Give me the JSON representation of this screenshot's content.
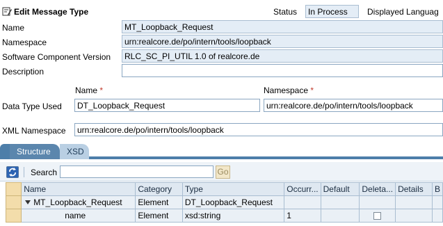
{
  "header": {
    "title": "Edit Message Type",
    "status_label": "Status",
    "status_value": "In Process",
    "displayed_language_label": "Displayed Languag"
  },
  "form": {
    "name_label": "Name",
    "name_value": "MT_Loopback_Request",
    "namespace_label": "Namespace",
    "namespace_value": "urn:realcore.de/po/intern/tools/loopback",
    "swcv_label": "Software Component Version",
    "swcv_value": "RLC_SC_PI_UTIL 1.0 of realcore.de",
    "description_label": "Description",
    "description_value": "",
    "dt_name_col": "Name",
    "dt_namespace_col": "Namespace",
    "required_mark": "*",
    "datatype_label": "Data Type Used",
    "datatype_name_value": "DT_Loopback_Request",
    "datatype_namespace_value": "urn:realcore.de/po/intern/tools/loopback",
    "xml_namespace_label": "XML Namespace",
    "xml_namespace_value": "urn:realcore.de/po/intern/tools/loopback"
  },
  "tabs": [
    {
      "label": "Structure",
      "active": true
    },
    {
      "label": "XSD",
      "active": false
    }
  ],
  "toolbar": {
    "search_label": "Search",
    "search_value": "",
    "go_label": "Go"
  },
  "table": {
    "columns": [
      "Name",
      "Category",
      "Type",
      "Occurr...",
      "Default",
      "Deleta...",
      "Details",
      "B"
    ],
    "rows": [
      {
        "name": "MT_Loopback_Request",
        "category": "Element",
        "type": "DT_Loopback_Request",
        "occurrence": "",
        "default": "",
        "deletable": false,
        "details": "",
        "expanded": true
      },
      {
        "name": "name",
        "category": "Element",
        "type": "xsd:string",
        "occurrence": "1",
        "default": "",
        "deletable": true,
        "details": ""
      }
    ]
  },
  "colors": {
    "tab_active": "#5b86ad",
    "tab_inactive": "#b9cfe3",
    "readonly_field": "#e4edf6",
    "selected_cell": "#f3ddab",
    "required": "#c0392b"
  },
  "icons": {
    "title": "edit-pencil-icon",
    "refresh": "refresh-icon",
    "expand": "triangle-down-icon"
  }
}
